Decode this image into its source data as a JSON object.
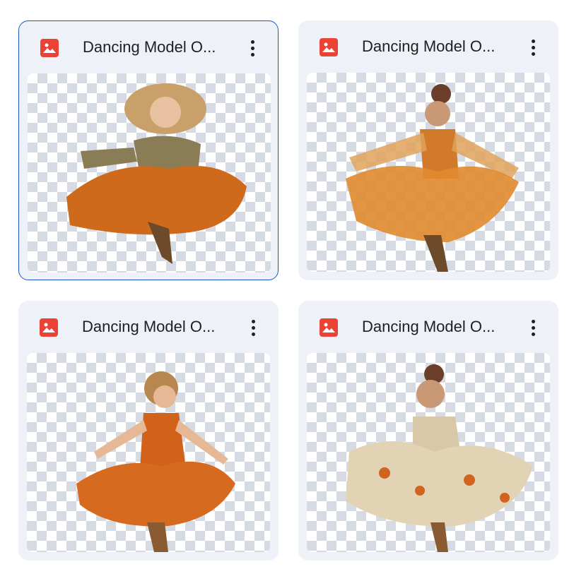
{
  "files": [
    {
      "title": "Dancing Model O...",
      "icon": "image-file-icon",
      "selected": true
    },
    {
      "title": "Dancing Model O...",
      "icon": "image-file-icon",
      "selected": false
    },
    {
      "title": "Dancing Model O...",
      "icon": "image-file-icon",
      "selected": false
    },
    {
      "title": "Dancing Model O...",
      "icon": "image-file-icon",
      "selected": false
    }
  ],
  "colors": {
    "card_bg": "#eef1f7",
    "selected_border": "#1a57c9",
    "icon_red": "#ea4335",
    "checker": "#d6dbe3"
  }
}
